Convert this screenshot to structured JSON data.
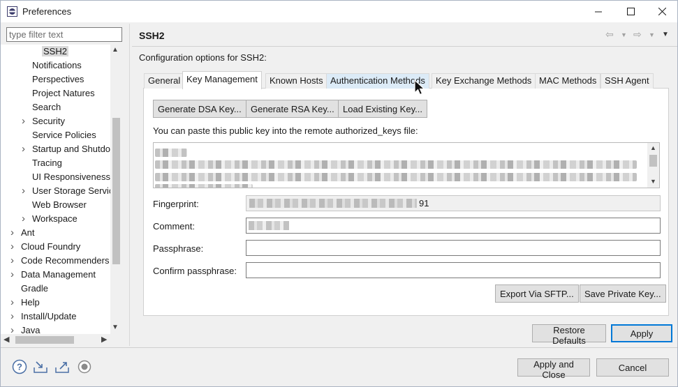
{
  "window": {
    "title": "Preferences"
  },
  "filter": {
    "placeholder": "type filter text"
  },
  "tree": {
    "items": [
      {
        "label": "SSH2",
        "indent": 2,
        "arrow": "",
        "selected": true
      },
      {
        "label": "Notifications",
        "indent": 2,
        "arrow": ""
      },
      {
        "label": "Perspectives",
        "indent": 2,
        "arrow": ""
      },
      {
        "label": "Project Natures",
        "indent": 2,
        "arrow": ""
      },
      {
        "label": "Search",
        "indent": 2,
        "arrow": ""
      },
      {
        "label": "Security",
        "indent": 2,
        "arrow": ">"
      },
      {
        "label": "Service Policies",
        "indent": 2,
        "arrow": ""
      },
      {
        "label": "Startup and Shutdo",
        "indent": 2,
        "arrow": ">"
      },
      {
        "label": "Tracing",
        "indent": 2,
        "arrow": ""
      },
      {
        "label": "UI Responsiveness",
        "indent": 2,
        "arrow": ""
      },
      {
        "label": "User Storage Servic",
        "indent": 2,
        "arrow": ">"
      },
      {
        "label": "Web Browser",
        "indent": 2,
        "arrow": ""
      },
      {
        "label": "Workspace",
        "indent": 2,
        "arrow": ">"
      },
      {
        "label": "Ant",
        "indent": 1,
        "arrow": ">"
      },
      {
        "label": "Cloud Foundry",
        "indent": 1,
        "arrow": ">"
      },
      {
        "label": "Code Recommenders",
        "indent": 1,
        "arrow": ">"
      },
      {
        "label": "Data Management",
        "indent": 1,
        "arrow": ">"
      },
      {
        "label": "Gradle",
        "indent": 1,
        "arrow": ""
      },
      {
        "label": "Help",
        "indent": 1,
        "arrow": ">"
      },
      {
        "label": "Install/Update",
        "indent": 1,
        "arrow": ">"
      },
      {
        "label": "Java",
        "indent": 1,
        "arrow": ">"
      }
    ]
  },
  "page": {
    "title": "SSH2",
    "config_label": "Configuration options for SSH2:"
  },
  "tabs": [
    {
      "label": "General"
    },
    {
      "label": "Key Management",
      "active": true
    },
    {
      "label": "Known Hosts"
    },
    {
      "label": "Authentication Methods",
      "hover": true
    },
    {
      "label": "Key Exchange Methods"
    },
    {
      "label": "MAC Methods"
    },
    {
      "label": "SSH Agent"
    }
  ],
  "key_management": {
    "generate_dsa": "Generate DSA Key...",
    "generate_rsa": "Generate RSA Key...",
    "load_existing": "Load Existing Key...",
    "paste_label": "You can paste this public key into the remote authorized_keys file:",
    "fingerprint_label": "Fingerprint:",
    "fingerprint_value": "91",
    "comment_label": "Comment:",
    "passphrase_label": "Passphrase:",
    "confirm_label": "Confirm passphrase:",
    "export_sftp": "Export Via SFTP...",
    "save_private": "Save Private Key..."
  },
  "footer": {
    "restore_defaults": "Restore Defaults",
    "apply": "Apply",
    "apply_close": "Apply and Close",
    "cancel": "Cancel"
  }
}
